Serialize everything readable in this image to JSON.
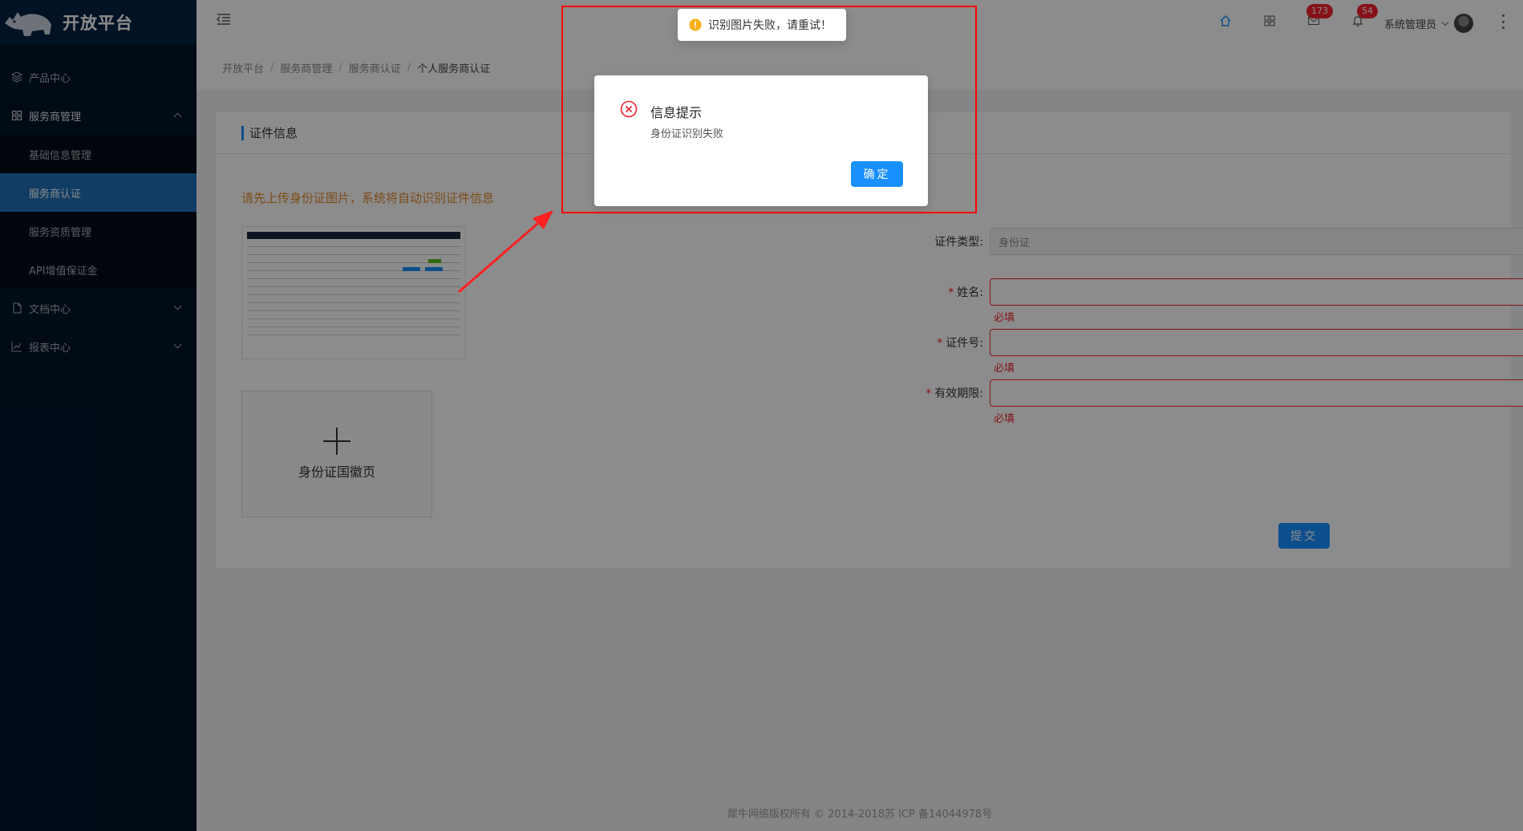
{
  "app": {
    "title": "开放平台"
  },
  "sidebar": {
    "items": [
      {
        "label": "产品中心",
        "icon": "layers-icon"
      },
      {
        "label": "服务商管理",
        "icon": "appstore-icon",
        "open": true,
        "children": [
          {
            "label": "基础信息管理"
          },
          {
            "label": "服务商认证",
            "active": true
          },
          {
            "label": "服务资质管理"
          },
          {
            "label": "API增值保证金"
          }
        ]
      },
      {
        "label": "文档中心",
        "icon": "file-icon"
      },
      {
        "label": "报表中心",
        "icon": "line-chart-icon"
      }
    ]
  },
  "header": {
    "mail_count": "173",
    "notice_count": "54",
    "user_name": "系统管理员"
  },
  "breadcrumb": [
    "开放平台",
    "服务商管理",
    "服务商认证",
    "个人服务商认证"
  ],
  "card": {
    "title": "证件信息",
    "upload_hint": "请先上传身份证图片，系统将自动识别证件信息",
    "uploader_label": "身份证国徽页"
  },
  "form": {
    "type_label": "证件类型:",
    "type_value": "身份证",
    "name_label": "姓名:",
    "id_label": "证件号:",
    "expiry_label": "有效期限:",
    "required_mark": "*",
    "error_text": "必填",
    "submit_label": "提交"
  },
  "footer": {
    "text": "犀牛网络版权所有 © 2014-2018苏 ICP 备14044978号"
  },
  "toast": {
    "text": "识别图片失败，请重试！"
  },
  "modal": {
    "title": "信息提示",
    "content": "身份证识别失败",
    "ok_label": "确定"
  },
  "colors": {
    "primary": "#1890ff",
    "sidebar_bg": "#001529",
    "error": "#f5222d",
    "warning": "#faad14",
    "hint": "#e38b2c"
  }
}
